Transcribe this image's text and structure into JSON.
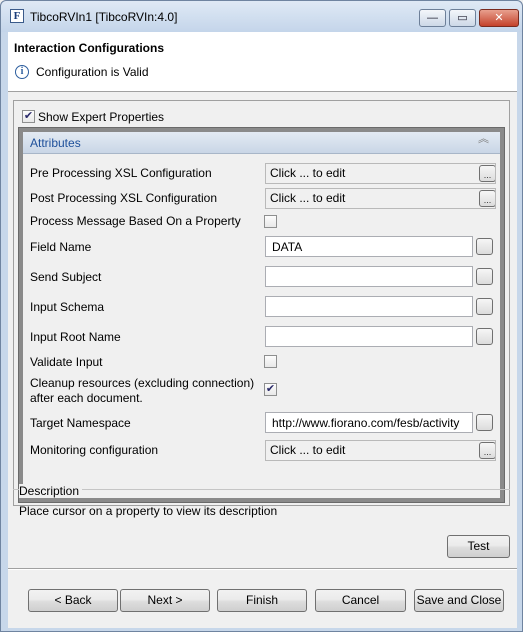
{
  "window": {
    "title": "TibcoRVIn1 [TibcoRVIn:4.0]",
    "app_icon": "F",
    "controls": {
      "minimize": "—",
      "maximize": "▭",
      "close": "✕"
    }
  },
  "header": {
    "title": "Interaction Configurations",
    "status": "Configuration is Valid",
    "status_icon": "info-icon"
  },
  "expert": {
    "label": "Show Expert Properties",
    "checked": true
  },
  "attributes": {
    "title": "Attributes",
    "collapse_glyph": "⌃⌃",
    "properties": [
      {
        "label": "Pre Processing XSL Configuration",
        "type": "editor",
        "value": "Click ... to edit"
      },
      {
        "label": "Post Processing XSL Configuration",
        "type": "editor",
        "value": "Click ... to edit"
      },
      {
        "label": "Process Message Based On a Property",
        "type": "checkbox",
        "checked": false
      },
      {
        "label": "Field Name",
        "type": "text",
        "value": "DATA"
      },
      {
        "label": "Send Subject",
        "type": "text",
        "value": ""
      },
      {
        "label": "Input Schema",
        "type": "text",
        "value": ""
      },
      {
        "label": "Input Root Name",
        "type": "text",
        "value": ""
      },
      {
        "label": "Validate Input",
        "type": "checkbox",
        "checked": false
      },
      {
        "label": "Cleanup resources (excluding connection)",
        "label2": "after each document.",
        "type": "checkbox",
        "checked": true
      },
      {
        "label": "Target Namespace",
        "type": "text",
        "value": "http://www.fiorano.com/fesb/activity"
      },
      {
        "label": "Monitoring configuration",
        "type": "editor",
        "value": "Click ... to edit"
      }
    ],
    "ellipsis": "..."
  },
  "description": {
    "title": "Description",
    "text": "Place cursor on a property to view its description"
  },
  "buttons": {
    "test": "Test",
    "back": "< Back",
    "next": "Next >",
    "finish": "Finish",
    "cancel": "Cancel",
    "save_close": "Save and Close"
  }
}
